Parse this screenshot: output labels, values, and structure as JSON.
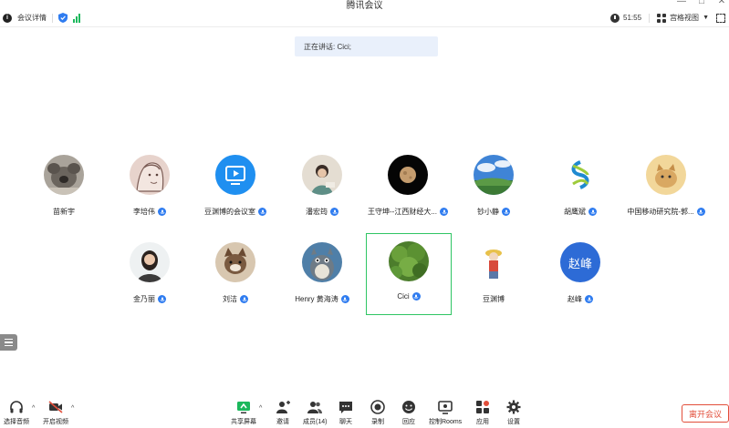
{
  "window": {
    "title": "腾讯会议"
  },
  "topbar": {
    "meeting_details": "会议详情",
    "timer": "51:55",
    "view_mode": "宫格视图"
  },
  "speaking": {
    "text": "正在讲话: Cici;"
  },
  "participants": [
    {
      "name": "苗新宇",
      "mic": false
    },
    {
      "name": "李培伟",
      "mic": true
    },
    {
      "name": "豆渊博的会议室",
      "mic": true
    },
    {
      "name": "潘宏筠",
      "mic": true
    },
    {
      "name": "王守坤--江西财经大...",
      "mic": true
    },
    {
      "name": "钞小静",
      "mic": true
    },
    {
      "name": "胡鹰斌",
      "mic": true
    },
    {
      "name": "中国移动研究院-郭...",
      "mic": true
    },
    {
      "name": "金乃丽",
      "mic": true
    },
    {
      "name": "刘洁",
      "mic": true
    },
    {
      "name": "Henry 黄海涛",
      "mic": true
    },
    {
      "name": "Cici",
      "mic": true,
      "active": true
    },
    {
      "name": "豆渊博",
      "mic": false
    },
    {
      "name": "赵峰",
      "mic": true,
      "avatar_text": "赵峰"
    }
  ],
  "toolbar": {
    "audio": "选择音频",
    "video": "开启视频",
    "share": "共享屏幕",
    "invite": "邀请",
    "members": "成员(14)",
    "chat": "聊天",
    "record": "录制",
    "replay": "回应",
    "rooms": "控制Rooms",
    "apps": "应用",
    "settings": "设置",
    "leave": "离开会议"
  },
  "colors": {
    "active_border": "#2fc563",
    "mic_badge": "#2f7cf0",
    "leave": "#e24e3a",
    "speaking_bg": "#e9f0fb"
  }
}
